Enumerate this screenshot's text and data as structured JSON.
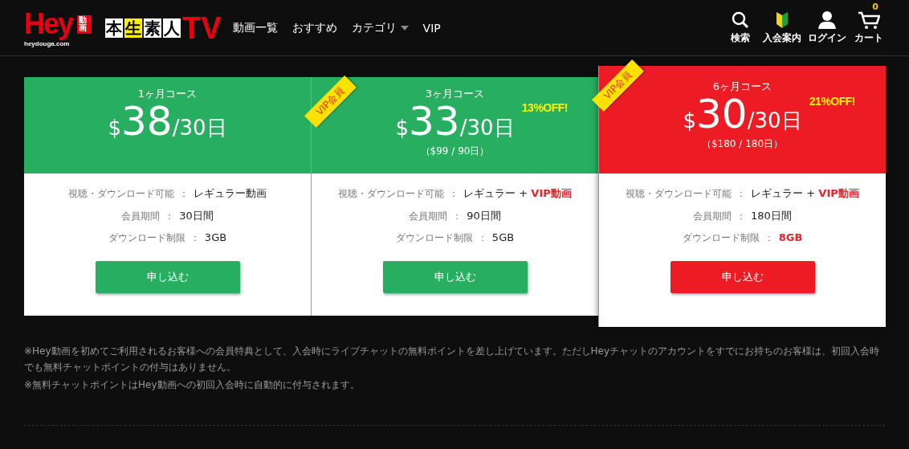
{
  "logo": {
    "brand": "Hey",
    "brand_tag": "動画",
    "domain": "heydouga.com",
    "series": [
      "本",
      "生",
      "素",
      "人"
    ],
    "series_tail": "TV"
  },
  "nav": [
    {
      "label": "動画一覧",
      "dropdown": false
    },
    {
      "label": "おすすめ",
      "dropdown": false
    },
    {
      "label": "カテゴリ",
      "dropdown": true
    },
    {
      "label": "VIP",
      "dropdown": false
    }
  ],
  "actions": [
    {
      "kind": "search",
      "label": "検索"
    },
    {
      "kind": "beginner",
      "label": "入会案内"
    },
    {
      "kind": "login",
      "label": "ログイン"
    },
    {
      "kind": "cart",
      "label": "カート",
      "count": "0"
    }
  ],
  "plans": [
    {
      "name": "1ヶ月コース",
      "currency": "$",
      "price": "38",
      "per": "/30日",
      "featured": false,
      "color": "#27ae60",
      "features": [
        {
          "label": "視聴・ダウンロード可能",
          "sep": "：",
          "value": [
            {
              "text": "レギュラー動画",
              "highlight": false
            }
          ]
        },
        {
          "label": "会員期間",
          "sep": "：",
          "value": [
            {
              "text": "30日間",
              "highlight": false
            }
          ]
        },
        {
          "label": "ダウンロード制限",
          "sep": "：",
          "value": [
            {
              "text": "3GB",
              "highlight": false
            }
          ]
        }
      ],
      "button": "申し込む"
    },
    {
      "name": "3ヶ月コース",
      "currency": "$",
      "price": "33",
      "per": "/30日",
      "total": "（$99 / 90日）",
      "discount": "13%OFF!",
      "badge": "VIP会員",
      "featured": false,
      "color": "#27ae60",
      "features": [
        {
          "label": "視聴・ダウンロード可能",
          "sep": "：",
          "value": [
            {
              "text": "レギュラー + ",
              "highlight": false
            },
            {
              "text": "VIP動画",
              "highlight": true
            }
          ]
        },
        {
          "label": "会員期間",
          "sep": "：",
          "value": [
            {
              "text": "90日間",
              "highlight": false
            }
          ]
        },
        {
          "label": "ダウンロード制限",
          "sep": "：",
          "value": [
            {
              "text": "5GB",
              "highlight": false
            }
          ]
        }
      ],
      "button": "申し込む"
    },
    {
      "name": "6ヶ月コース",
      "currency": "$",
      "price": "30",
      "per": "/30日",
      "total": "（$180 / 180日）",
      "discount": "21%OFF!",
      "badge": "VIP会員",
      "featured": true,
      "color": "#ed1c24",
      "features": [
        {
          "label": "視聴・ダウンロード可能",
          "sep": "：",
          "value": [
            {
              "text": "レギュラー + ",
              "highlight": false
            },
            {
              "text": "VIP動画",
              "highlight": true
            }
          ]
        },
        {
          "label": "会員期間",
          "sep": "：",
          "value": [
            {
              "text": "180日間",
              "highlight": false
            }
          ]
        },
        {
          "label": "ダウンロード制限",
          "sep": "：",
          "value": [
            {
              "text": "8GB",
              "highlight": true
            }
          ]
        }
      ],
      "button": "申し込む"
    }
  ],
  "notes": [
    "※Hey動画を初めてご利用されるお客様への会員特典として、入会時にライブチャットの無料ポイントを差し上げています。ただしHeyチャットのアカウントをすでにお持ちのお客様は、初回入会時でも無料チャットポイントの付与はありません。",
    "※無料チャットポイントはHey動画への初回入会時に自動的に付与されます。"
  ]
}
